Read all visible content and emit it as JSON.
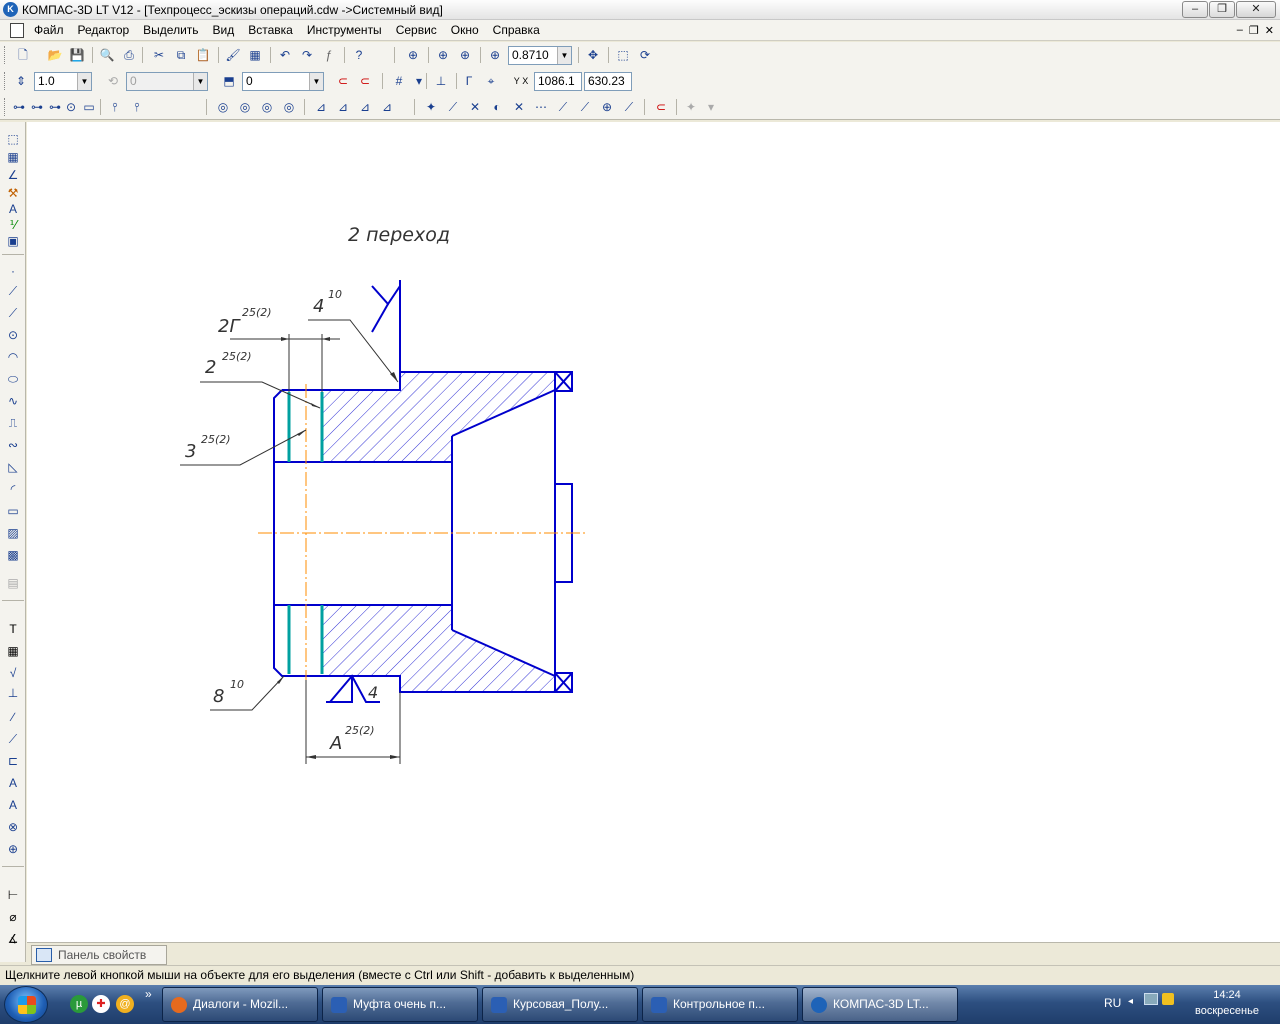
{
  "window": {
    "title": "КОМПАС-3D LT V12 - [Техпроцесс_эскизы операций.cdw ->Системный вид]",
    "app_logo": "K",
    "controls": [
      "–",
      "❐",
      "✕"
    ]
  },
  "menu": {
    "items": [
      "Файл",
      "Редактор",
      "Выделить",
      "Вид",
      "Вставка",
      "Инструменты",
      "Сервис",
      "Окно",
      "Справка"
    ],
    "mdi_controls": [
      "–",
      "❐",
      "✕"
    ]
  },
  "toolbar": {
    "zoom_value": "0.8710",
    "line_step": "1.0",
    "angle_step": "0",
    "layer_value": "0",
    "coord_x": "1086.1",
    "coord_y": "630.23",
    "coord_label": "Y X"
  },
  "drawing": {
    "caption": "2 переход",
    "labels": {
      "dim_2g": "2Г",
      "tol_2g": "25(2)",
      "dim_4": "4",
      "tol_4": "10",
      "dim_2": "2",
      "tol_2": "25(2)",
      "dim_3": "3",
      "tol_3": "25(2)",
      "dim_8": "8",
      "tol_8": "10",
      "dim_a": "А",
      "tol_a": "25(2)",
      "base_4": "4"
    }
  },
  "panel": {
    "properties_tab": "Панель свойств"
  },
  "status": {
    "text": "Щелкните левой кнопкой мыши на объекте для его выделения (вместе с Ctrl или Shift - добавить к выделенным)"
  },
  "taskbar": {
    "tasks": [
      {
        "label": "Диалоги - Mozil...",
        "color": "#e66a1e"
      },
      {
        "label": "Муфта очень п...",
        "color": "#2b5fb4"
      },
      {
        "label": "Курсовая_Полу...",
        "color": "#2b5fb4"
      },
      {
        "label": "Контрольное п...",
        "color": "#2b5fb4"
      },
      {
        "label": "КОМПАС-3D LT...",
        "color": "#1e63b8"
      }
    ],
    "lang": "RU",
    "time": "14:24",
    "day": "воскресенье",
    "more": "»"
  },
  "colors": {
    "outline": "#0000cc",
    "axis": "#ff8c00",
    "surface": "#00a0a0",
    "text": "#333333"
  }
}
